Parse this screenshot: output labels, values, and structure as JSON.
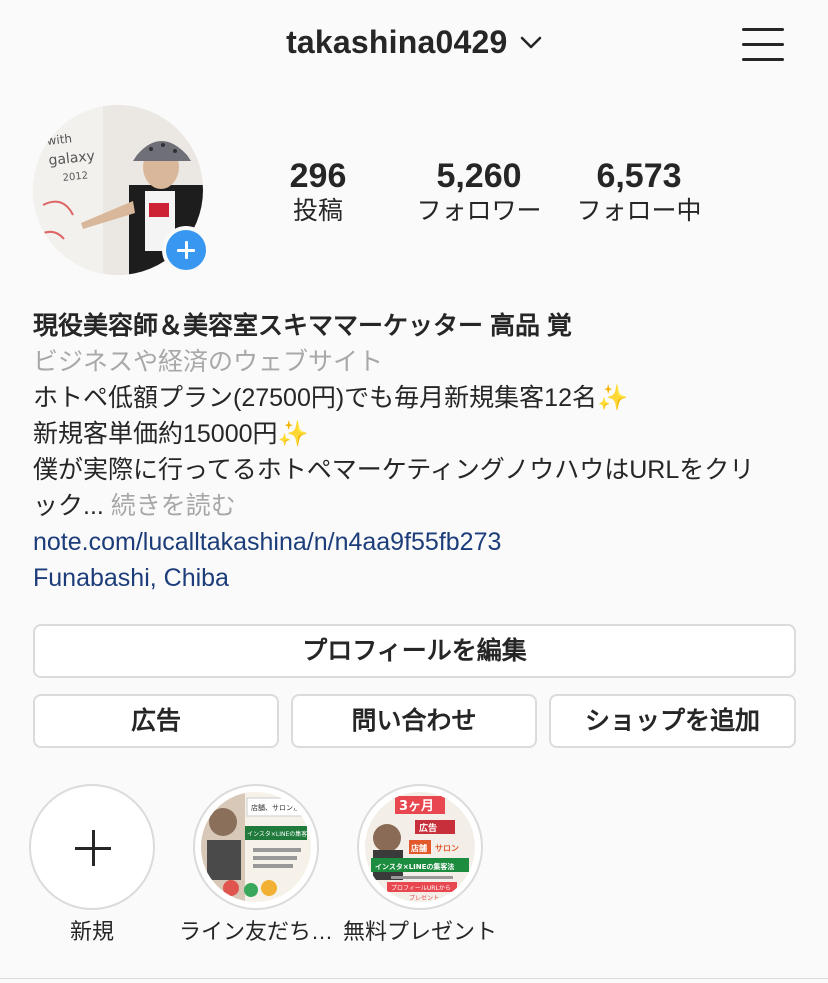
{
  "header": {
    "username": "takashina0429"
  },
  "stats": [
    {
      "value": "296",
      "label": "投稿"
    },
    {
      "value": "5,260",
      "label": "フォロワー"
    },
    {
      "value": "6,573",
      "label": "フォロー中"
    }
  ],
  "bio": {
    "name": "現役美容師＆美容室スキママーケッター 高品 覚",
    "category": "ビジネスや経済のウェブサイト",
    "line1": "ホトペ低額プラン(27500円)でも毎月新規集客12名",
    "line2": "新規客単価約15000円",
    "line3": "僕が実際に行ってるホトペマーケティングノウハウはURLをクリ",
    "line4": "ック...",
    "more": "続きを読む",
    "link": "note.com/lucalltakashina/n/n4aa9f55fb273",
    "location": "Funabashi, Chiba",
    "sparkle": "✨"
  },
  "buttons": {
    "edit_profile": "プロフィールを編集",
    "ads": "広告",
    "contact": "問い合わせ",
    "add_shop": "ショップを追加"
  },
  "highlights": [
    {
      "label": "新規"
    },
    {
      "label": "ライン友だち…"
    },
    {
      "label": "無料プレゼント"
    }
  ],
  "highlight_text": {
    "h2_a": "店舗、サロンが",
    "h2_b": "インスタ×LINEの集客方法",
    "h3_a": "3ヶ月",
    "h3_b": "広告",
    "h3_c": "店舗",
    "h3_d": "サロン",
    "h3_e": "インスタ×LINEの集客法",
    "h3_f": "プロフィールURLから",
    "h3_g": "プレゼント"
  },
  "colors": {
    "accent_blue": "#3897f0",
    "link": "#1c3d7a",
    "muted": "#a8a8a8",
    "border": "#dbdbdb"
  }
}
